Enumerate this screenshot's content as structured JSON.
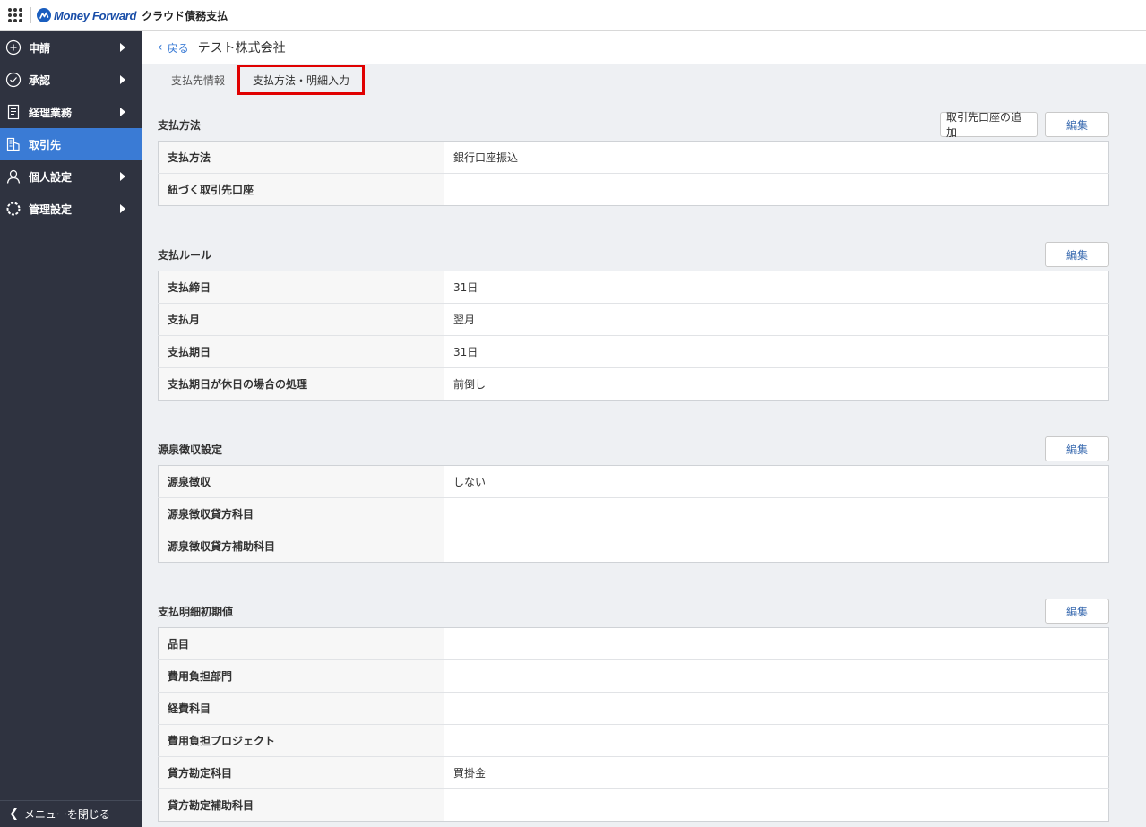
{
  "header": {
    "brand": "Money Forward",
    "product": "クラウド債務支払"
  },
  "sidebar": {
    "items": [
      {
        "label": "申請",
        "icon": "plus-circle-icon",
        "arrow": true
      },
      {
        "label": "承認",
        "icon": "check-circle-icon",
        "arrow": true
      },
      {
        "label": "経理業務",
        "icon": "document-icon",
        "arrow": true
      },
      {
        "label": "取引先",
        "icon": "building-icon",
        "arrow": false,
        "active": true
      },
      {
        "label": "個人設定",
        "icon": "person-icon",
        "arrow": true
      },
      {
        "label": "管理設定",
        "icon": "gear-icon",
        "arrow": true
      }
    ],
    "footer_label": "メニューを閉じる"
  },
  "breadcrumb": {
    "back_label": "戻る",
    "title": "テスト株式会社"
  },
  "tabs": [
    {
      "label": "支払先情報",
      "active": false
    },
    {
      "label": "支払方法・明細入力",
      "active": true
    }
  ],
  "sections": [
    {
      "title": "支払方法",
      "buttons": [
        "取引先口座の追加",
        "編集"
      ],
      "rows": [
        {
          "label": "支払方法",
          "value": "銀行口座振込"
        },
        {
          "label": "紐づく取引先口座",
          "value": ""
        }
      ]
    },
    {
      "title": "支払ルール",
      "buttons": [
        "編集"
      ],
      "rows": [
        {
          "label": "支払締日",
          "value": "31日"
        },
        {
          "label": "支払月",
          "value": "翌月"
        },
        {
          "label": "支払期日",
          "value": "31日"
        },
        {
          "label": "支払期日が休日の場合の処理",
          "value": "前倒し"
        }
      ]
    },
    {
      "title": "源泉徴収設定",
      "buttons": [
        "編集"
      ],
      "rows": [
        {
          "label": "源泉徴収",
          "value": "しない"
        },
        {
          "label": "源泉徴収貸方科目",
          "value": ""
        },
        {
          "label": "源泉徴収貸方補助科目",
          "value": ""
        }
      ]
    },
    {
      "title": "支払明細初期値",
      "buttons": [
        "編集"
      ],
      "rows": [
        {
          "label": "品目",
          "value": ""
        },
        {
          "label": "費用負担部門",
          "value": ""
        },
        {
          "label": "経費科目",
          "value": ""
        },
        {
          "label": "費用負担プロジェクト",
          "value": ""
        },
        {
          "label": "貸方勘定科目",
          "value": "買掛金"
        },
        {
          "label": "貸方勘定補助科目",
          "value": ""
        }
      ]
    }
  ]
}
